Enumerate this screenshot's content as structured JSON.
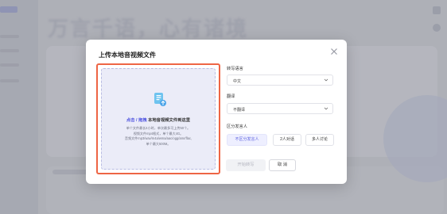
{
  "background": {
    "headline": "万言千语，心有诸境"
  },
  "modal": {
    "title": "上传本地音视频文件",
    "close_icon": "close-icon"
  },
  "upload": {
    "icon": "document-upload-icon",
    "click_text": "点击",
    "separator": " / ",
    "drag_text": "拖拽",
    "main_suffix": " 本地音视频文件到这里",
    "hints": [
      "单个文件最长4小时，单次最多可上传50个。",
      "视频文件mp4格式，单个最大4G。",
      "音频文件mp3/wav/m4a/wma/aac/ogg/amr/flac,",
      "单个最大500M。"
    ]
  },
  "form": {
    "language_label": "转写语言",
    "language_value": "中文",
    "translate_label": "翻译",
    "translate_value": "不翻译",
    "speaker_label": "区分发言人",
    "speaker_options": [
      "不区分发言人",
      "2人对话",
      "多人讨论"
    ],
    "speaker_selected_index": 0
  },
  "buttons": {
    "start_label": "开始转写",
    "cancel_label": "取 消"
  },
  "colors": {
    "accent": "#5a5fe0",
    "highlight_outline": "#ee6545"
  }
}
